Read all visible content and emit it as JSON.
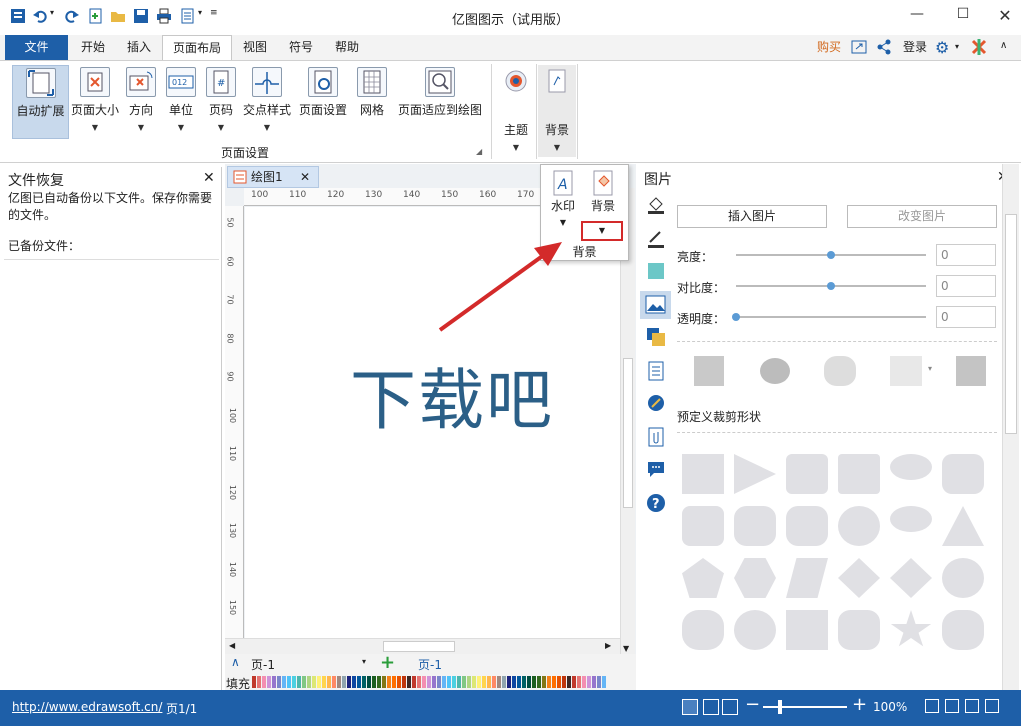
{
  "window": {
    "title": "亿图图示（试用版）"
  },
  "tabs": [
    {
      "label": "文件"
    },
    {
      "label": "开始"
    },
    {
      "label": "插入"
    },
    {
      "label": "页面布局"
    },
    {
      "label": "视图"
    },
    {
      "label": "符号"
    },
    {
      "label": "帮助"
    }
  ],
  "top_right": {
    "buy": "购买",
    "login": "登录"
  },
  "ribbon": {
    "buttons": [
      {
        "label": "自动扩展"
      },
      {
        "label": "页面大小"
      },
      {
        "label": "方向"
      },
      {
        "label": "单位"
      },
      {
        "label": "页码"
      },
      {
        "label": "交点样式"
      },
      {
        "label": "页面设置"
      },
      {
        "label": "网格"
      },
      {
        "label": "页面适应到绘图"
      }
    ],
    "group_label": "页面设置",
    "theme_label": "主题",
    "bg_label": "背景"
  },
  "left_panel": {
    "title": "文件恢复",
    "message": "亿图已自动备份以下文件。保存你需要的文件。",
    "backed_up": "已备份文件："
  },
  "document": {
    "tab_label": "绘图1",
    "hruler_ticks": [
      "100",
      "110",
      "120",
      "130",
      "140",
      "150",
      "160",
      "170"
    ],
    "vruler_ticks": [
      "50",
      "60",
      "70",
      "80",
      "90",
      "100",
      "110",
      "120",
      "130",
      "140",
      "150"
    ],
    "watermark_text": "下载吧",
    "page_name": "页-1",
    "page_tab": "页-1",
    "fill_label": "填充"
  },
  "popup": {
    "watermark_label": "水印",
    "background_label": "背景",
    "group_label": "背景"
  },
  "right_panel": {
    "title": "图片",
    "insert_btn": "插入图片",
    "change_btn": "改变图片",
    "brightness": {
      "label": "亮度：",
      "value": "0",
      "level": 0.5
    },
    "contrast": {
      "label": "对比度：",
      "value": "0",
      "level": 0.5
    },
    "transparency": {
      "label": "透明度：",
      "value": "0",
      "level": 0.0
    },
    "crop_label": "预定义裁剪形状"
  },
  "status": {
    "url": "http://www.edrawsoft.cn/",
    "page_info": "页1/1",
    "zoom": "100%"
  },
  "colors": {
    "accent": "#1e5fa8",
    "arrow": "#d32a2a",
    "watermark": "#2b5f87"
  }
}
